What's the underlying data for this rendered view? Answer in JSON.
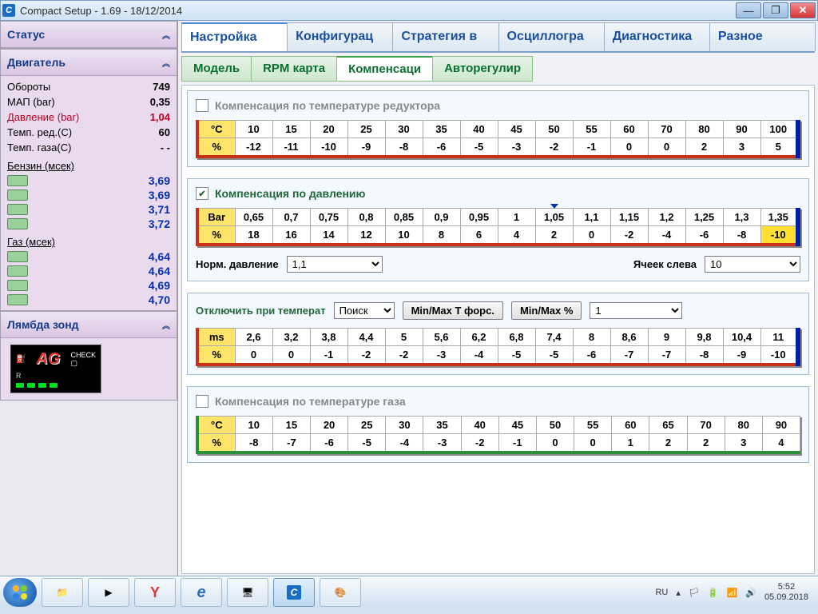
{
  "window": {
    "title": "Compact Setup - 1.69 - 18/12/2014"
  },
  "sidebar": {
    "status_label": "Статус",
    "engine_label": "Двигатель",
    "engine": [
      {
        "label": "Обороты",
        "value": "749"
      },
      {
        "label": "МАП (bar)",
        "value": "0,35"
      },
      {
        "label": "Давление (bar)",
        "value": "1,04",
        "red": true
      },
      {
        "label": "Темп. ред.(C)",
        "value": "60"
      },
      {
        "label": "Темп. газа(C)",
        "value": "- -"
      }
    ],
    "petrol_label": "Бензин (мсек)",
    "petrol": [
      "3,69",
      "3,69",
      "3,71",
      "3,72"
    ],
    "gas_label": "Газ (мсек)",
    "gas": [
      "4,64",
      "4,64",
      "4,69",
      "4,70"
    ],
    "lambda_label": "Лямбда зонд"
  },
  "tabs": [
    "Настройка",
    "Конфигурац",
    "Стратегия в",
    "Осциллогра",
    "Диагностика",
    "Разное"
  ],
  "subtabs": [
    "Модель",
    "RPM карта",
    "Компенсаци",
    "Авторегулир"
  ],
  "sec1": {
    "title": "Компенсация по температуре редуктора",
    "checked": false,
    "row_hdr_top": "°C",
    "row_hdr_bot": "%",
    "temps": [
      "10",
      "15",
      "20",
      "25",
      "30",
      "35",
      "40",
      "45",
      "50",
      "55",
      "60",
      "70",
      "80",
      "90",
      "100"
    ],
    "vals": [
      "-12",
      "-11",
      "-10",
      "-9",
      "-8",
      "-6",
      "-5",
      "-3",
      "-2",
      "-1",
      "0",
      "0",
      "2",
      "3",
      "5"
    ]
  },
  "sec2": {
    "title": "Компенсация по давлению",
    "checked": true,
    "row_hdr_top": "Bar",
    "row_hdr_bot": "%",
    "bars": [
      "0,65",
      "0,7",
      "0,75",
      "0,8",
      "0,85",
      "0,9",
      "0,95",
      "1",
      "1,05",
      "1,1",
      "1,15",
      "1,2",
      "1,25",
      "1,3",
      "1,35"
    ],
    "vals": [
      "18",
      "16",
      "14",
      "12",
      "10",
      "8",
      "6",
      "4",
      "2",
      "0",
      "-2",
      "-4",
      "-6",
      "-8",
      "-10"
    ],
    "indicator_col": 8,
    "mark_col": 14,
    "norm_label": "Норм. давление",
    "norm_val": "1,1",
    "cells_label": "Ячеек слева",
    "cells_val": "10"
  },
  "sec3": {
    "top_label": "Отключить при температ",
    "combo1": "Поиск",
    "btn1": "Min/Max T форс.",
    "btn2": "Min/Max %",
    "combo2": "1",
    "row_hdr_top": "ms",
    "row_hdr_bot": "%",
    "ms": [
      "2,6",
      "3,2",
      "3,8",
      "4,4",
      "5",
      "5,6",
      "6,2",
      "6,8",
      "7,4",
      "8",
      "8,6",
      "9",
      "9,8",
      "10,4",
      "11"
    ],
    "vals": [
      "0",
      "0",
      "-1",
      "-2",
      "-2",
      "-3",
      "-4",
      "-5",
      "-5",
      "-6",
      "-7",
      "-7",
      "-8",
      "-9",
      "-10"
    ]
  },
  "sec4": {
    "title": "Компенсация по температуре газа",
    "checked": false,
    "row_hdr_top": "°C",
    "row_hdr_bot": "%",
    "temps": [
      "10",
      "15",
      "20",
      "25",
      "30",
      "35",
      "40",
      "45",
      "50",
      "55",
      "60",
      "65",
      "70",
      "80",
      "90"
    ],
    "vals": [
      "-8",
      "-7",
      "-6",
      "-5",
      "-4",
      "-3",
      "-2",
      "-1",
      "0",
      "0",
      "1",
      "2",
      "2",
      "3",
      "4"
    ]
  },
  "tray": {
    "lang": "RU",
    "time": "5:52",
    "date": "05.09.2018"
  }
}
